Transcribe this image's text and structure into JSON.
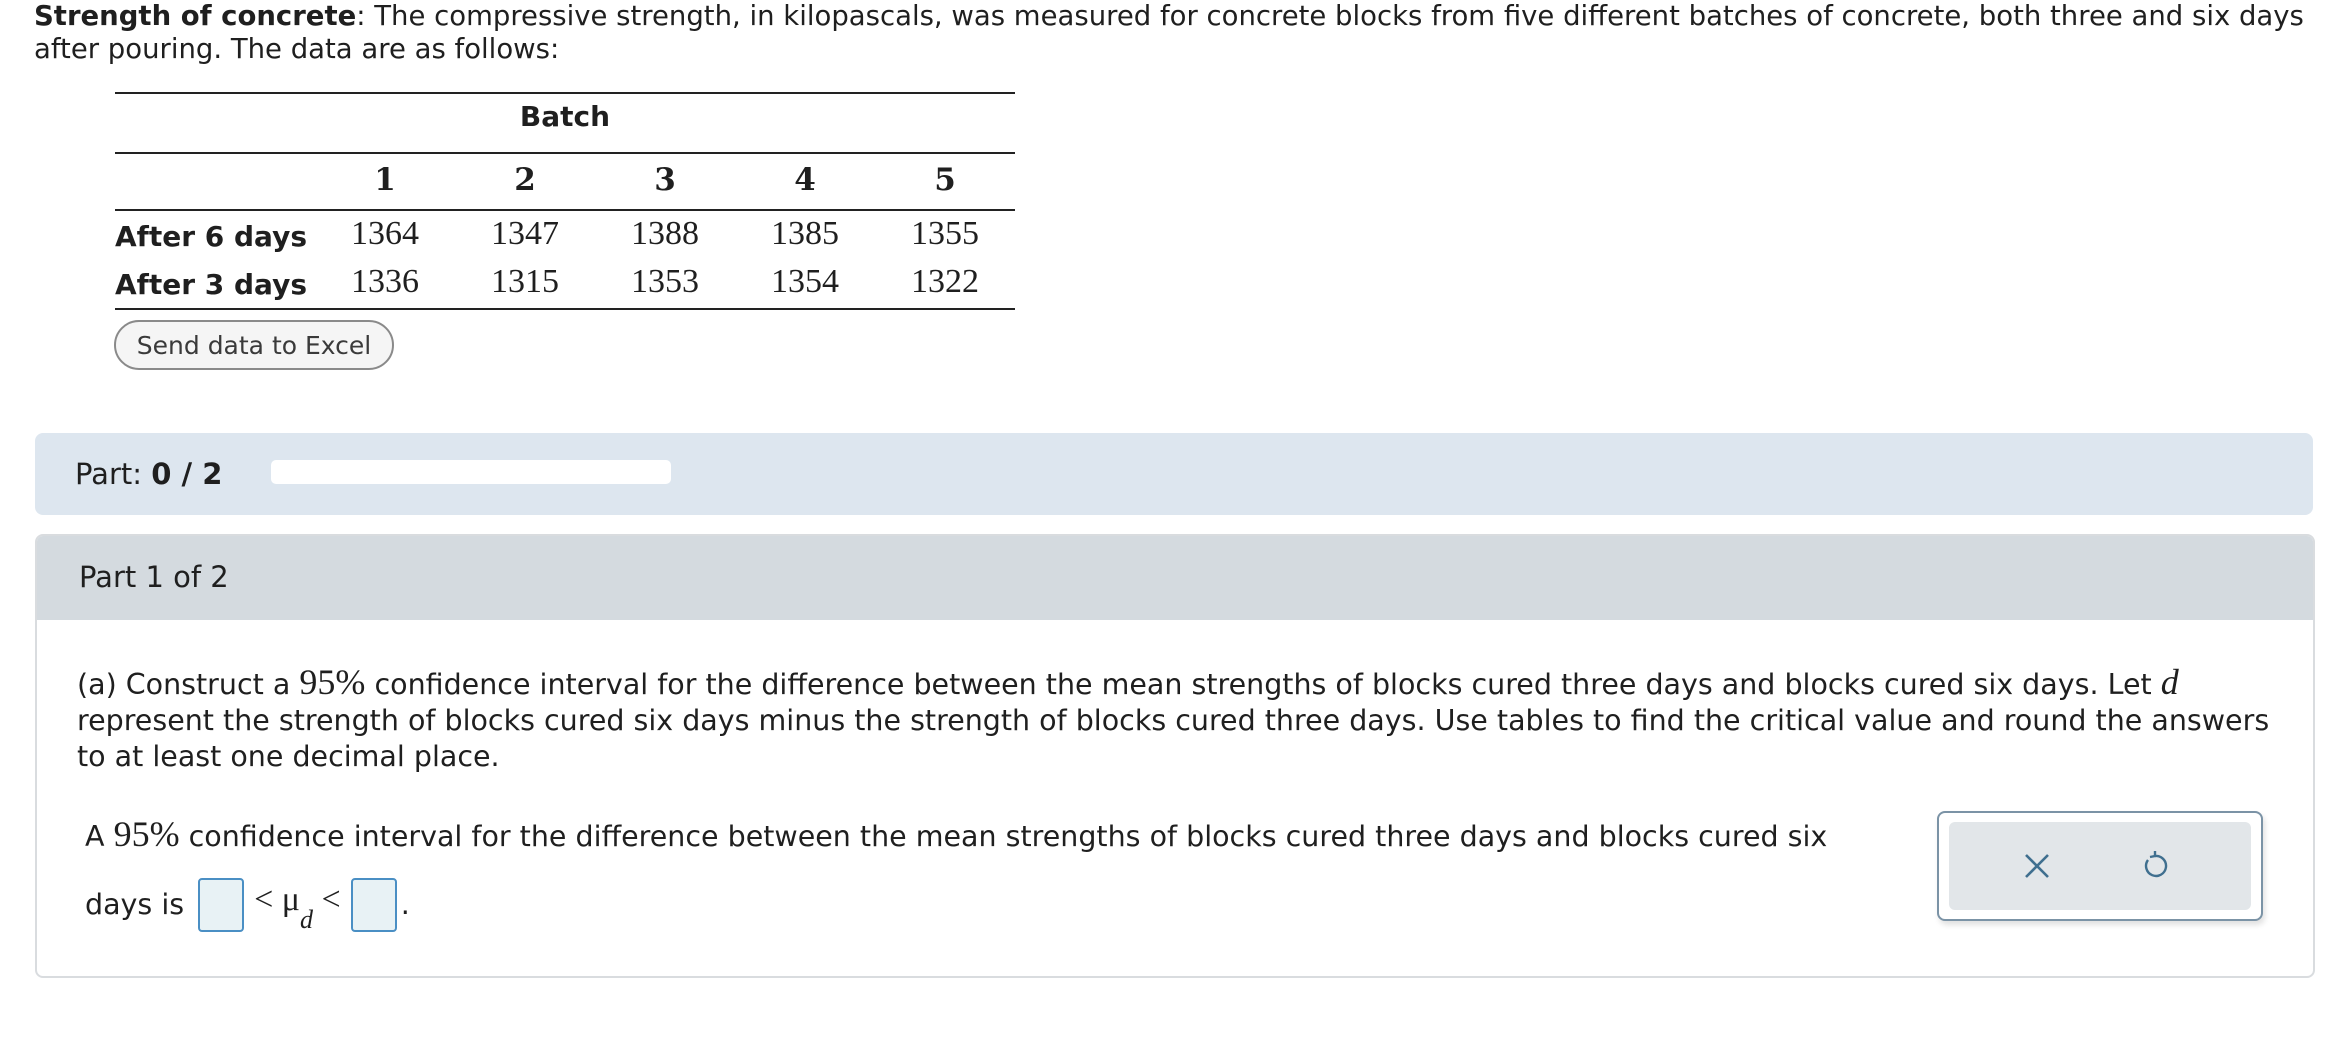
{
  "intro": {
    "title": "Strength of concrete",
    "text": ": The compressive strength, in kilopascals, was measured for concrete blocks from five different batches of concrete, both three and six days after pouring. The data are as follows:"
  },
  "table": {
    "group_header": "Batch",
    "columns": [
      "1",
      "2",
      "3",
      "4",
      "5"
    ],
    "rows": [
      {
        "label": "After 6 days",
        "values": [
          "1364",
          "1347",
          "1388",
          "1385",
          "1355"
        ]
      },
      {
        "label": "After 3 days",
        "values": [
          "1336",
          "1315",
          "1353",
          "1354",
          "1322"
        ]
      }
    ]
  },
  "excel_button": "Send data to Excel",
  "part_bar": {
    "label": "Part:",
    "value": "0 / 2",
    "progress_fraction": 0
  },
  "part_panel": {
    "heading": "Part 1 of 2",
    "question_a_prefix": "(a) Construct a",
    "question_pct": "95%",
    "question_mid": "confidence interval for the difference between the mean strengths of blocks cured three days and blocks cured six days. Let",
    "question_var": "d",
    "question_rest": "represent the strength of blocks cured six days minus the strength of blocks cured three days. Use tables to find the critical value and round the answers to at least one decimal place.",
    "answer_prefix": "A",
    "answer_pct": "95%",
    "answer_text": "confidence interval for the difference between the mean strengths of blocks cured three days and blocks cured six",
    "answer_line2": "days is",
    "lt": "<",
    "mu": "μ",
    "mu_sub": "d",
    "period": ".",
    "lower_value": "",
    "upper_value": ""
  },
  "toolbox": {
    "clear_icon": "close-icon",
    "undo_icon": "undo-icon"
  }
}
